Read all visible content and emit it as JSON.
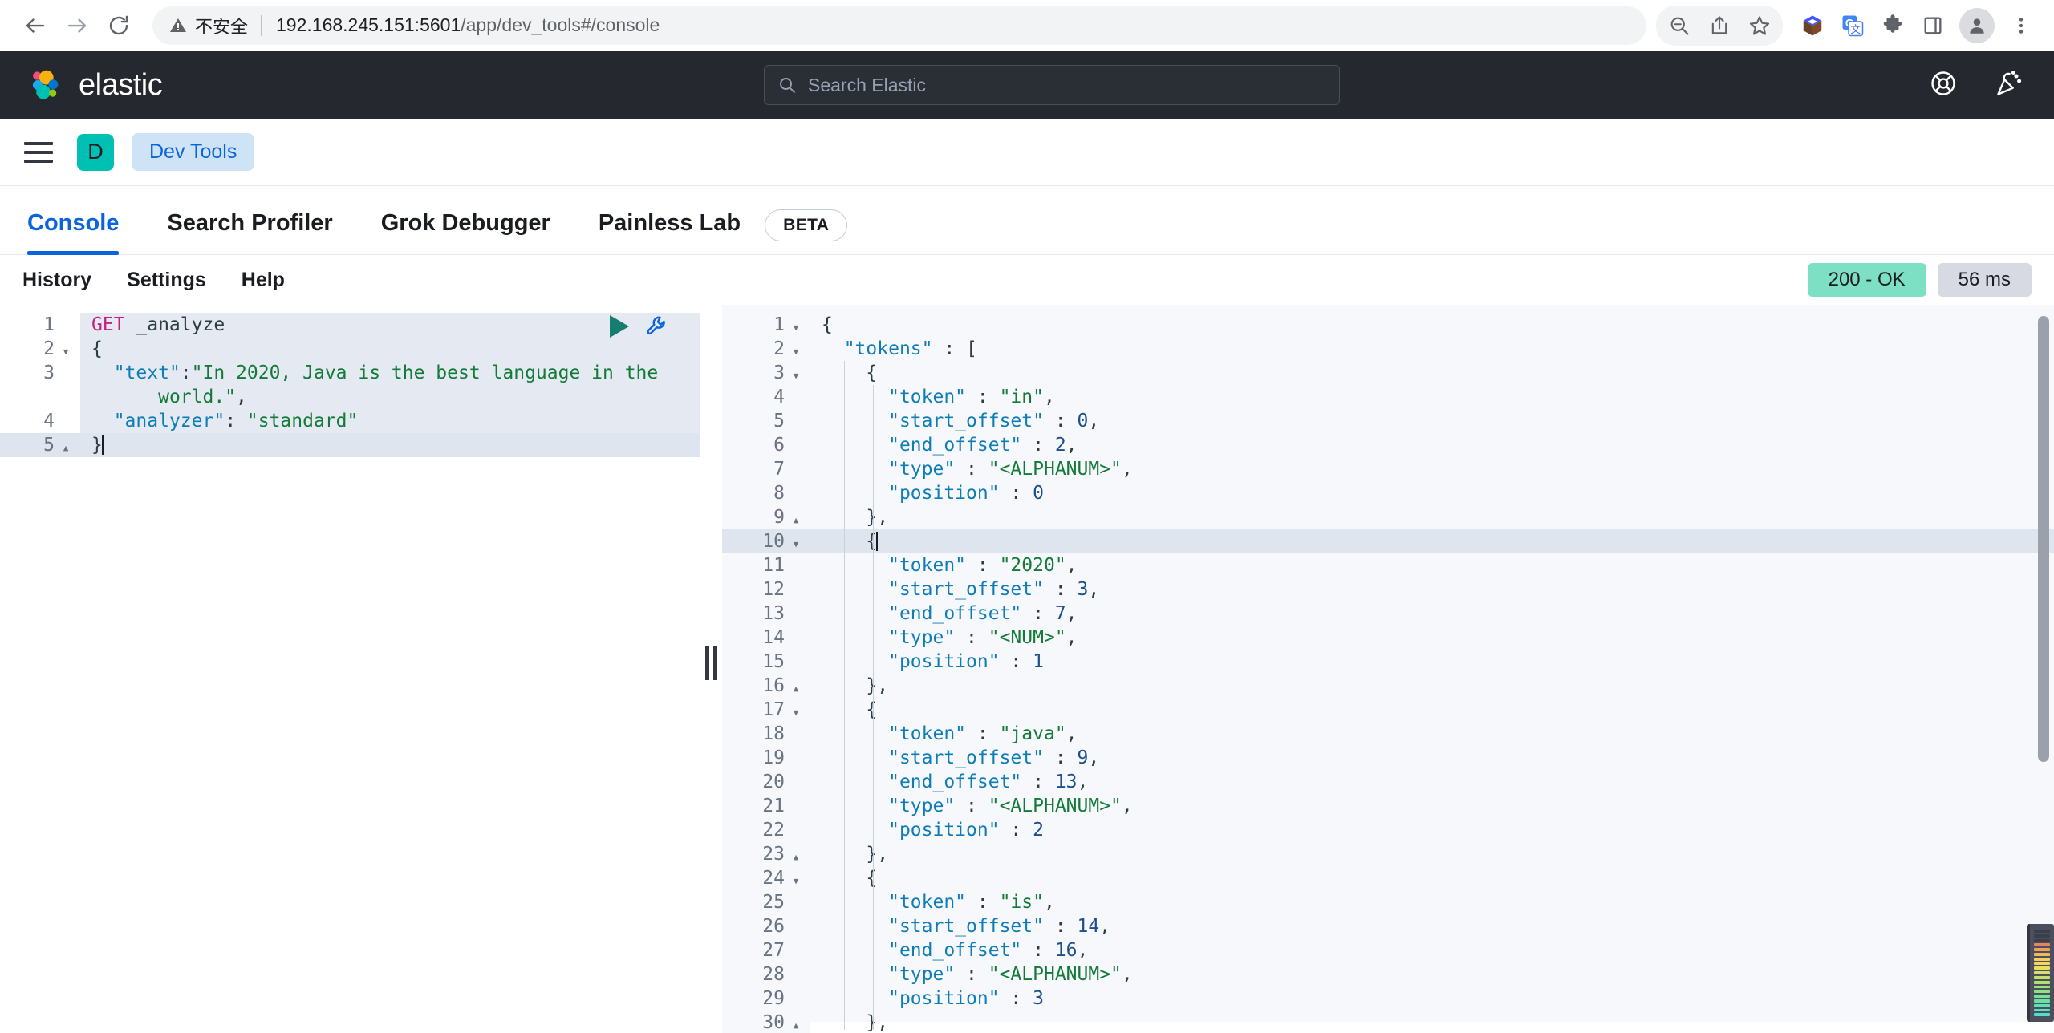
{
  "browser": {
    "back_icon": "back-arrow-icon",
    "forward_icon": "forward-arrow-icon",
    "reload_icon": "reload-icon",
    "security_label": "不安全",
    "url_host": "192.168.245.151:5601",
    "url_path": "/app/dev_tools#/console",
    "actions": [
      {
        "name": "zoom-out-icon",
        "glyph": "zoom-out"
      },
      {
        "name": "share-icon",
        "glyph": "share"
      },
      {
        "name": "bookmark-star-icon",
        "glyph": "star"
      }
    ],
    "extensions": [
      {
        "name": "cube-extension-icon"
      },
      {
        "name": "google-translate-icon"
      },
      {
        "name": "puzzle-extensions-icon"
      },
      {
        "name": "side-panel-icon"
      }
    ],
    "profile_icon": "profile-avatar-icon",
    "menu_icon": "three-dot-menu-icon"
  },
  "header": {
    "brand": "elastic",
    "search_placeholder": "Search Elastic",
    "search_icon": "search-icon",
    "help_icon": "help-lifebuoy-icon",
    "news_icon": "party-popper-news-icon"
  },
  "nav": {
    "menu_icon": "hamburger-menu-icon",
    "space_initial": "D",
    "breadcrumb": "Dev Tools"
  },
  "tabs": [
    {
      "label": "Console",
      "active": true
    },
    {
      "label": "Search Profiler",
      "active": false
    },
    {
      "label": "Grok Debugger",
      "active": false
    },
    {
      "label": "Painless Lab",
      "active": false
    }
  ],
  "beta_badge": "BETA",
  "console_toolbar": {
    "links": [
      "History",
      "Settings",
      "Help"
    ],
    "status_code": "200 - OK",
    "elapsed": "56 ms",
    "status_color": "#7ddfc3",
    "elapsed_color": "#d7dae2"
  },
  "editor_actions": {
    "play_icon": "run-request-play-icon",
    "wrench_icon": "request-options-wrench-icon"
  },
  "resizer": {
    "name": "pane-resizer-handle"
  },
  "request_editor": {
    "lines": [
      {
        "n": "1",
        "fold": "none",
        "active": false,
        "tokens": [
          {
            "t": "GET ",
            "c": "tk-method"
          },
          {
            "t": "_analyze",
            "c": "tk-url"
          }
        ]
      },
      {
        "n": "2",
        "fold": "down",
        "active": false,
        "tokens": [
          {
            "t": "{",
            "c": "tk-punc"
          }
        ]
      },
      {
        "n": "3",
        "fold": "none",
        "active": false,
        "tokens": [
          {
            "t": "  ",
            "c": "tk-punc"
          },
          {
            "t": "\"text\"",
            "c": "tk-key"
          },
          {
            "t": ":",
            "c": "tk-punc"
          },
          {
            "t": "\"In 2020, Java is the best language in the",
            "c": "tk-str"
          }
        ]
      },
      {
        "n": "",
        "fold": "none",
        "active": false,
        "tokens": [
          {
            "t": "      ",
            "c": "tk-punc"
          },
          {
            "t": "world.\"",
            "c": "tk-str"
          },
          {
            "t": ",",
            "c": "tk-punc"
          }
        ]
      },
      {
        "n": "4",
        "fold": "none",
        "active": false,
        "tokens": [
          {
            "t": "  ",
            "c": "tk-punc"
          },
          {
            "t": "\"analyzer\"",
            "c": "tk-key"
          },
          {
            "t": ": ",
            "c": "tk-punc"
          },
          {
            "t": "\"standard\"",
            "c": "tk-str"
          }
        ]
      },
      {
        "n": "5",
        "fold": "up",
        "active": true,
        "cursor": true,
        "tokens": [
          {
            "t": "}",
            "c": "tk-punc"
          }
        ]
      }
    ]
  },
  "response_editor": {
    "lines": [
      {
        "n": "1",
        "fold": "down",
        "active": false,
        "tokens": [
          {
            "t": "{",
            "c": "tk-punc"
          }
        ]
      },
      {
        "n": "2",
        "fold": "down",
        "active": false,
        "tokens": [
          {
            "t": "  ",
            "c": "tk-punc"
          },
          {
            "t": "\"tokens\"",
            "c": "tk-key"
          },
          {
            "t": " : [",
            "c": "tk-punc"
          }
        ]
      },
      {
        "n": "3",
        "fold": "down",
        "active": false,
        "tokens": [
          {
            "t": "    {",
            "c": "tk-punc"
          }
        ]
      },
      {
        "n": "4",
        "fold": "none",
        "active": false,
        "tokens": [
          {
            "t": "      ",
            "c": "tk-punc"
          },
          {
            "t": "\"token\"",
            "c": "tk-key"
          },
          {
            "t": " : ",
            "c": "tk-punc"
          },
          {
            "t": "\"in\"",
            "c": "tk-str"
          },
          {
            "t": ",",
            "c": "tk-punc"
          }
        ]
      },
      {
        "n": "5",
        "fold": "none",
        "active": false,
        "tokens": [
          {
            "t": "      ",
            "c": "tk-punc"
          },
          {
            "t": "\"start_offset\"",
            "c": "tk-key"
          },
          {
            "t": " : ",
            "c": "tk-punc"
          },
          {
            "t": "0",
            "c": "tk-num"
          },
          {
            "t": ",",
            "c": "tk-punc"
          }
        ]
      },
      {
        "n": "6",
        "fold": "none",
        "active": false,
        "tokens": [
          {
            "t": "      ",
            "c": "tk-punc"
          },
          {
            "t": "\"end_offset\"",
            "c": "tk-key"
          },
          {
            "t": " : ",
            "c": "tk-punc"
          },
          {
            "t": "2",
            "c": "tk-num"
          },
          {
            "t": ",",
            "c": "tk-punc"
          }
        ]
      },
      {
        "n": "7",
        "fold": "none",
        "active": false,
        "tokens": [
          {
            "t": "      ",
            "c": "tk-punc"
          },
          {
            "t": "\"type\"",
            "c": "tk-key"
          },
          {
            "t": " : ",
            "c": "tk-punc"
          },
          {
            "t": "\"<ALPHANUM>\"",
            "c": "tk-str"
          },
          {
            "t": ",",
            "c": "tk-punc"
          }
        ]
      },
      {
        "n": "8",
        "fold": "none",
        "active": false,
        "tokens": [
          {
            "t": "      ",
            "c": "tk-punc"
          },
          {
            "t": "\"position\"",
            "c": "tk-key"
          },
          {
            "t": " : ",
            "c": "tk-punc"
          },
          {
            "t": "0",
            "c": "tk-num"
          }
        ]
      },
      {
        "n": "9",
        "fold": "up",
        "active": false,
        "tokens": [
          {
            "t": "    },",
            "c": "tk-punc"
          }
        ]
      },
      {
        "n": "10",
        "fold": "down",
        "active": true,
        "cursor": true,
        "tokens": [
          {
            "t": "    {",
            "c": "tk-punc"
          }
        ]
      },
      {
        "n": "11",
        "fold": "none",
        "active": false,
        "tokens": [
          {
            "t": "      ",
            "c": "tk-punc"
          },
          {
            "t": "\"token\"",
            "c": "tk-key"
          },
          {
            "t": " : ",
            "c": "tk-punc"
          },
          {
            "t": "\"2020\"",
            "c": "tk-str"
          },
          {
            "t": ",",
            "c": "tk-punc"
          }
        ]
      },
      {
        "n": "12",
        "fold": "none",
        "active": false,
        "tokens": [
          {
            "t": "      ",
            "c": "tk-punc"
          },
          {
            "t": "\"start_offset\"",
            "c": "tk-key"
          },
          {
            "t": " : ",
            "c": "tk-punc"
          },
          {
            "t": "3",
            "c": "tk-num"
          },
          {
            "t": ",",
            "c": "tk-punc"
          }
        ]
      },
      {
        "n": "13",
        "fold": "none",
        "active": false,
        "tokens": [
          {
            "t": "      ",
            "c": "tk-punc"
          },
          {
            "t": "\"end_offset\"",
            "c": "tk-key"
          },
          {
            "t": " : ",
            "c": "tk-punc"
          },
          {
            "t": "7",
            "c": "tk-num"
          },
          {
            "t": ",",
            "c": "tk-punc"
          }
        ]
      },
      {
        "n": "14",
        "fold": "none",
        "active": false,
        "tokens": [
          {
            "t": "      ",
            "c": "tk-punc"
          },
          {
            "t": "\"type\"",
            "c": "tk-key"
          },
          {
            "t": " : ",
            "c": "tk-punc"
          },
          {
            "t": "\"<NUM>\"",
            "c": "tk-str"
          },
          {
            "t": ",",
            "c": "tk-punc"
          }
        ]
      },
      {
        "n": "15",
        "fold": "none",
        "active": false,
        "tokens": [
          {
            "t": "      ",
            "c": "tk-punc"
          },
          {
            "t": "\"position\"",
            "c": "tk-key"
          },
          {
            "t": " : ",
            "c": "tk-punc"
          },
          {
            "t": "1",
            "c": "tk-num"
          }
        ]
      },
      {
        "n": "16",
        "fold": "up",
        "active": false,
        "tokens": [
          {
            "t": "    },",
            "c": "tk-punc"
          }
        ]
      },
      {
        "n": "17",
        "fold": "down",
        "active": false,
        "tokens": [
          {
            "t": "    {",
            "c": "tk-punc"
          }
        ]
      },
      {
        "n": "18",
        "fold": "none",
        "active": false,
        "tokens": [
          {
            "t": "      ",
            "c": "tk-punc"
          },
          {
            "t": "\"token\"",
            "c": "tk-key"
          },
          {
            "t": " : ",
            "c": "tk-punc"
          },
          {
            "t": "\"java\"",
            "c": "tk-str"
          },
          {
            "t": ",",
            "c": "tk-punc"
          }
        ]
      },
      {
        "n": "19",
        "fold": "none",
        "active": false,
        "tokens": [
          {
            "t": "      ",
            "c": "tk-punc"
          },
          {
            "t": "\"start_offset\"",
            "c": "tk-key"
          },
          {
            "t": " : ",
            "c": "tk-punc"
          },
          {
            "t": "9",
            "c": "tk-num"
          },
          {
            "t": ",",
            "c": "tk-punc"
          }
        ]
      },
      {
        "n": "20",
        "fold": "none",
        "active": false,
        "tokens": [
          {
            "t": "      ",
            "c": "tk-punc"
          },
          {
            "t": "\"end_offset\"",
            "c": "tk-key"
          },
          {
            "t": " : ",
            "c": "tk-punc"
          },
          {
            "t": "13",
            "c": "tk-num"
          },
          {
            "t": ",",
            "c": "tk-punc"
          }
        ]
      },
      {
        "n": "21",
        "fold": "none",
        "active": false,
        "tokens": [
          {
            "t": "      ",
            "c": "tk-punc"
          },
          {
            "t": "\"type\"",
            "c": "tk-key"
          },
          {
            "t": " : ",
            "c": "tk-punc"
          },
          {
            "t": "\"<ALPHANUM>\"",
            "c": "tk-str"
          },
          {
            "t": ",",
            "c": "tk-punc"
          }
        ]
      },
      {
        "n": "22",
        "fold": "none",
        "active": false,
        "tokens": [
          {
            "t": "      ",
            "c": "tk-punc"
          },
          {
            "t": "\"position\"",
            "c": "tk-key"
          },
          {
            "t": " : ",
            "c": "tk-punc"
          },
          {
            "t": "2",
            "c": "tk-num"
          }
        ]
      },
      {
        "n": "23",
        "fold": "up",
        "active": false,
        "tokens": [
          {
            "t": "    },",
            "c": "tk-punc"
          }
        ]
      },
      {
        "n": "24",
        "fold": "down",
        "active": false,
        "tokens": [
          {
            "t": "    {",
            "c": "tk-punc"
          }
        ]
      },
      {
        "n": "25",
        "fold": "none",
        "active": false,
        "tokens": [
          {
            "t": "      ",
            "c": "tk-punc"
          },
          {
            "t": "\"token\"",
            "c": "tk-key"
          },
          {
            "t": " : ",
            "c": "tk-punc"
          },
          {
            "t": "\"is\"",
            "c": "tk-str"
          },
          {
            "t": ",",
            "c": "tk-punc"
          }
        ]
      },
      {
        "n": "26",
        "fold": "none",
        "active": false,
        "tokens": [
          {
            "t": "      ",
            "c": "tk-punc"
          },
          {
            "t": "\"start_offset\"",
            "c": "tk-key"
          },
          {
            "t": " : ",
            "c": "tk-punc"
          },
          {
            "t": "14",
            "c": "tk-num"
          },
          {
            "t": ",",
            "c": "tk-punc"
          }
        ]
      },
      {
        "n": "27",
        "fold": "none",
        "active": false,
        "tokens": [
          {
            "t": "      ",
            "c": "tk-punc"
          },
          {
            "t": "\"end_offset\"",
            "c": "tk-key"
          },
          {
            "t": " : ",
            "c": "tk-punc"
          },
          {
            "t": "16",
            "c": "tk-num"
          },
          {
            "t": ",",
            "c": "tk-punc"
          }
        ]
      },
      {
        "n": "28",
        "fold": "none",
        "active": false,
        "tokens": [
          {
            "t": "      ",
            "c": "tk-punc"
          },
          {
            "t": "\"type\"",
            "c": "tk-key"
          },
          {
            "t": " : ",
            "c": "tk-punc"
          },
          {
            "t": "\"<ALPHANUM>\"",
            "c": "tk-str"
          },
          {
            "t": ",",
            "c": "tk-punc"
          }
        ]
      },
      {
        "n": "29",
        "fold": "none",
        "active": false,
        "tokens": [
          {
            "t": "      ",
            "c": "tk-punc"
          },
          {
            "t": "\"position\"",
            "c": "tk-key"
          },
          {
            "t": " : ",
            "c": "tk-punc"
          },
          {
            "t": "3",
            "c": "tk-num"
          }
        ]
      },
      {
        "n": "30",
        "fold": "up",
        "active": false,
        "tokens": [
          {
            "t": "    },",
            "c": "tk-punc"
          }
        ]
      }
    ]
  },
  "level_meter": {
    "name": "audio-level-meter-overlay",
    "segments": [
      "#3a3f4b",
      "#3a3f4b",
      "#3a3f4b",
      "#e8825f",
      "#efa05a",
      "#f3b75c",
      "#f5cc5e",
      "#f2d75f",
      "#e9dd62",
      "#d8e066",
      "#c6e06b",
      "#b2e070",
      "#9fe07a",
      "#8ce086",
      "#79e095",
      "#6ae0a5",
      "#5fe0b4",
      "#57dfc0",
      "#52dfc9"
    ]
  }
}
